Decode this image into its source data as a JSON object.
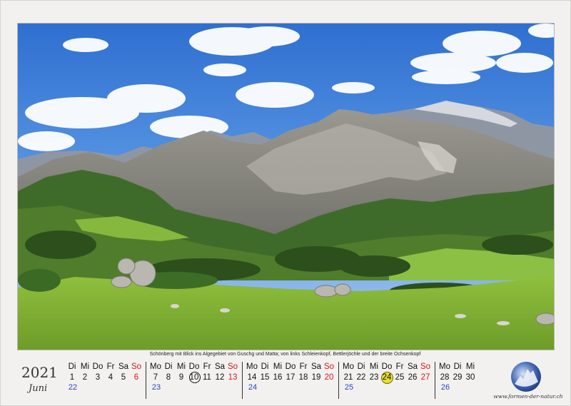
{
  "caption": "Schönberg mit Blick ins Algegebiet von Guschg und Matta; von links Schleienkopf, Bettlerjöchle und der breite Ochsenkopf",
  "year": "2021",
  "month": "Juni",
  "weeks": [
    {
      "days": [
        [
          "Di",
          "1"
        ],
        [
          "Mi",
          "2"
        ],
        [
          "Do",
          "3"
        ],
        [
          "Fr",
          "4"
        ],
        [
          "Sa",
          "5"
        ],
        [
          "So",
          "6"
        ]
      ],
      "kw": "22",
      "lead": 1
    },
    {
      "days": [
        [
          "Mo",
          "7"
        ],
        [
          "Di",
          "8"
        ],
        [
          "Mi",
          "9"
        ],
        [
          "Do",
          "10"
        ],
        [
          "Fr",
          "11"
        ],
        [
          "Sa",
          "12"
        ],
        [
          "So",
          "13"
        ]
      ],
      "kw": "23"
    },
    {
      "days": [
        [
          "Mo",
          "14"
        ],
        [
          "Di",
          "15"
        ],
        [
          "Mi",
          "16"
        ],
        [
          "Do",
          "17"
        ],
        [
          "Fr",
          "18"
        ],
        [
          "Sa",
          "19"
        ],
        [
          "So",
          "20"
        ]
      ],
      "kw": "24"
    },
    {
      "days": [
        [
          "Mo",
          "21"
        ],
        [
          "Di",
          "22"
        ],
        [
          "Mi",
          "23"
        ],
        [
          "Do",
          "24"
        ],
        [
          "Fr",
          "25"
        ],
        [
          "Sa",
          "26"
        ],
        [
          "So",
          "27"
        ]
      ],
      "kw": "25"
    },
    {
      "days": [
        [
          "Mo",
          "28"
        ],
        [
          "Di",
          "29"
        ],
        [
          "Mi",
          "30"
        ]
      ],
      "kw": "26"
    }
  ],
  "marked_circle": "10",
  "marked_dot": "24",
  "colors": {
    "sunday": "#d21a1a",
    "week_number": "#2a3fd0",
    "highlight": "#e8e02a"
  },
  "logo_text": "www.formen-der-natur.ch"
}
